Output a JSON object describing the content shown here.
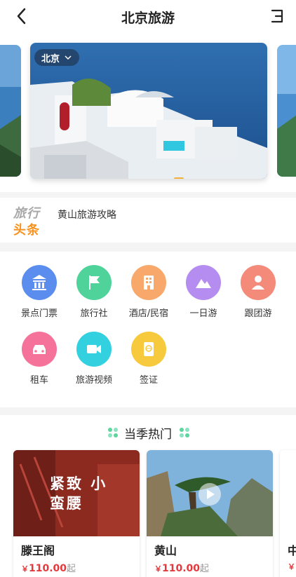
{
  "header": {
    "title": "北京旅游",
    "back_icon": "chevron-left-icon",
    "menu_icon": "menu-icon"
  },
  "banner": {
    "city": "北京",
    "city_dropdown_icon": "chevron-down-icon",
    "active_slide": 1
  },
  "headline": {
    "logo_top": "旅行",
    "logo_bottom": "头条",
    "text": "黄山旅游攻略"
  },
  "categories": [
    {
      "label": "景点门票",
      "icon": "landmark-icon",
      "color": "#5b8def"
    },
    {
      "label": "旅行社",
      "icon": "flag-icon",
      "color": "#4fd39a"
    },
    {
      "label": "酒店/民宿",
      "icon": "building-icon",
      "color": "#f7a86a"
    },
    {
      "label": "一日游",
      "icon": "mountain-icon",
      "color": "#b58df0"
    },
    {
      "label": "跟团游",
      "icon": "group-icon",
      "color": "#f48a7a"
    },
    {
      "label": "租车",
      "icon": "car-icon",
      "color": "#f5739b"
    },
    {
      "label": "旅游视频",
      "icon": "video-icon",
      "color": "#33d1e0"
    },
    {
      "label": "签证",
      "icon": "passport-icon",
      "color": "#f7c93c"
    }
  ],
  "hot": {
    "title": "当季热门",
    "cards": [
      {
        "name": "滕王阁",
        "currency": "￥",
        "price": "110.00",
        "suffix": "起",
        "image_text": "紧致 小蛮腰"
      },
      {
        "name": "黄山",
        "currency": "￥",
        "price": "110.00",
        "suffix": "起",
        "image_text": ""
      },
      {
        "name": "中",
        "currency": "￥",
        "price": "",
        "suffix": "",
        "image_text": ""
      }
    ]
  },
  "colors": {
    "accent_orange": "#f6921e",
    "price_red": "#e4393c",
    "indicator": "#f3b13a"
  }
}
